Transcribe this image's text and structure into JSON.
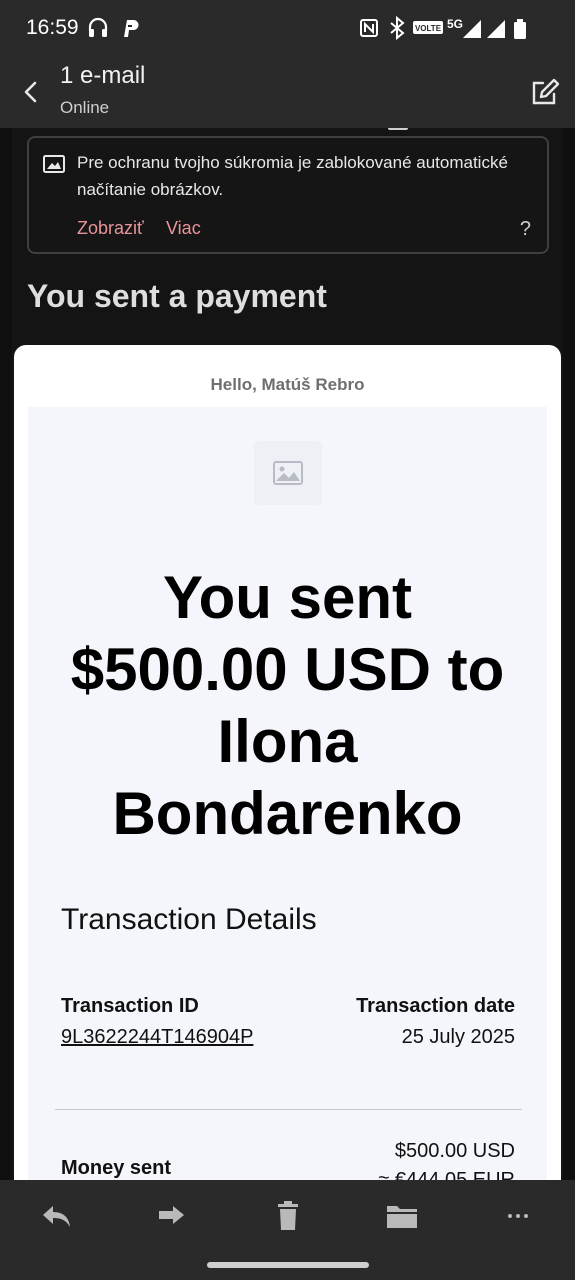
{
  "status_bar": {
    "time": "16:59",
    "left_icons": [
      "headphones-icon",
      "paypal-icon"
    ],
    "right_icons": [
      "nfc-icon",
      "bluetooth-icon",
      "volte-icon",
      "5g-icon",
      "signal-icon",
      "signal-icon",
      "battery-icon"
    ],
    "network_label": "5G",
    "volte_label": "VOLTE"
  },
  "app_bar": {
    "title": "1 e-mail",
    "subtitle": "Online"
  },
  "privacy_banner": {
    "text": "Pre ochranu tvojho súkromia je zablokované automatické načítanie obrázkov.",
    "show_label": "Zobraziť",
    "more_label": "Viac",
    "help_label": "?"
  },
  "email": {
    "subject": "You sent a payment",
    "greeting": "Hello, Matúš Rebro",
    "headline": "You sent $500.00 USD to Ilona Bondarenko",
    "details_title": "Transaction Details",
    "transaction_id_label": "Transaction ID",
    "transaction_id": "9L3622244T146904P",
    "transaction_date_label": "Transaction date",
    "transaction_date": "25 July 2025",
    "money_sent_label": "Money sent",
    "money_sent_usd": "$500.00 USD",
    "money_sent_eur": "≈ €444.05 EUR"
  },
  "bottom_bar": {
    "actions": [
      "reply-icon",
      "forward-icon",
      "delete-icon",
      "move-to-folder-icon",
      "more-icon"
    ]
  },
  "colors": {
    "accent": "#e9949a",
    "background": "#0f0f0f",
    "bar": "#2a2a2a"
  }
}
